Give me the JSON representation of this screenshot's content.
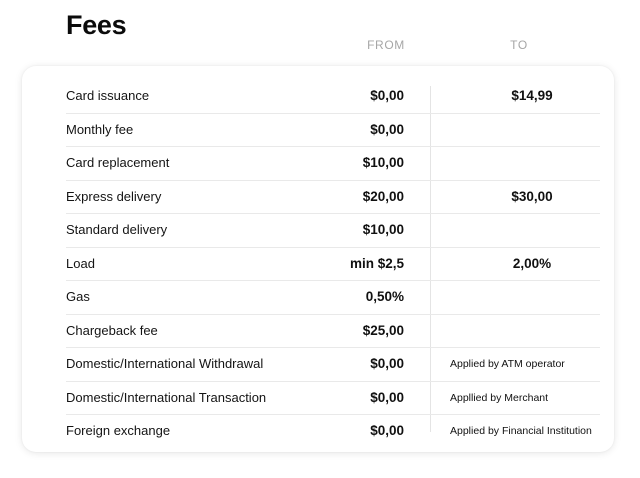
{
  "title": "Fees",
  "columns": {
    "from": "FROM",
    "to": "TO"
  },
  "rows": [
    {
      "label": "Card issuance",
      "from": "$0,00",
      "to": "$14,99"
    },
    {
      "label": "Monthly fee",
      "from": "$0,00",
      "to": ""
    },
    {
      "label": "Card replacement",
      "from": "$10,00",
      "to": ""
    },
    {
      "label": "Express delivery",
      "from": "$20,00",
      "to": "$30,00"
    },
    {
      "label": "Standard delivery",
      "from": "$10,00",
      "to": ""
    },
    {
      "label": "Load",
      "from": "min $2,5",
      "to": "2,00%"
    },
    {
      "label": "Gas",
      "from": "0,50%",
      "to": ""
    },
    {
      "label": "Chargeback fee",
      "from": "$25,00",
      "to": ""
    },
    {
      "label": "Domestic/International Withdrawal",
      "from": "$0,00",
      "to": "Applied by ATM operator"
    },
    {
      "label": "Domestic/International Transaction",
      "from": "$0,00",
      "to": "Appllied by Merchant"
    },
    {
      "label": "Foreign exchange",
      "from": "$0,00",
      "to": "Applied by Financial Institution"
    }
  ]
}
